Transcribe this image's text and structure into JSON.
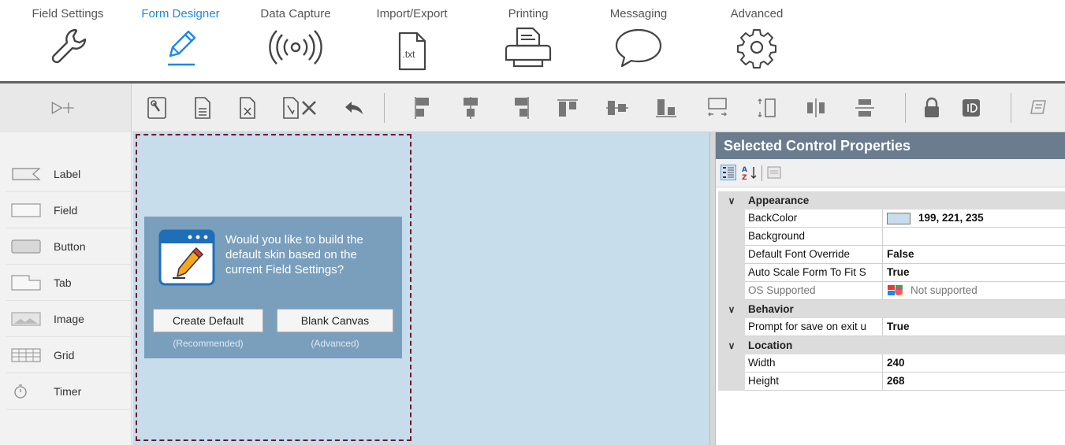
{
  "ribbon": {
    "tabs": [
      {
        "label": "Field Settings"
      },
      {
        "label": "Form Designer"
      },
      {
        "label": "Data Capture"
      },
      {
        "label": "Import/Export",
        "icon_text": ".txt"
      },
      {
        "label": "Printing"
      },
      {
        "label": "Messaging"
      },
      {
        "label": "Advanced"
      }
    ],
    "active_color": "#1e88e5"
  },
  "toolbox": {
    "items": [
      {
        "label": "Label"
      },
      {
        "label": "Field"
      },
      {
        "label": "Button"
      },
      {
        "label": "Tab"
      },
      {
        "label": "Image"
      },
      {
        "label": "Grid"
      },
      {
        "label": "Timer"
      }
    ]
  },
  "dialog": {
    "message": "Would you like to build the default skin based on the current Field Settings?",
    "create_label": "Create Default",
    "create_sub": "(Recommended)",
    "blank_label": "Blank Canvas",
    "blank_sub": "(Advanced)"
  },
  "properties": {
    "title": "Selected Control Properties",
    "categories": [
      {
        "name": "Appearance",
        "rows": [
          {
            "name": "BackColor",
            "value": "199, 221, 235",
            "swatch": "#c7ddeb"
          },
          {
            "name": "Background",
            "value": ""
          },
          {
            "name": "Default Font Override",
            "value": "False"
          },
          {
            "name": "Auto Scale Form To Fit S",
            "value": "True"
          },
          {
            "name": "OS Supported",
            "value": "Not supported"
          }
        ]
      },
      {
        "name": "Behavior",
        "rows": [
          {
            "name": "Prompt for save on exit u",
            "value": "True"
          }
        ]
      },
      {
        "name": "Location",
        "rows": [
          {
            "name": "Width",
            "value": "240"
          },
          {
            "name": "Height",
            "value": "268"
          }
        ]
      }
    ]
  },
  "colors": {
    "canvas": "#c7ddeb",
    "dialog": "#7a9fbd",
    "props_header": "#6a7c8e",
    "form_outline": "#6a1b2a"
  }
}
